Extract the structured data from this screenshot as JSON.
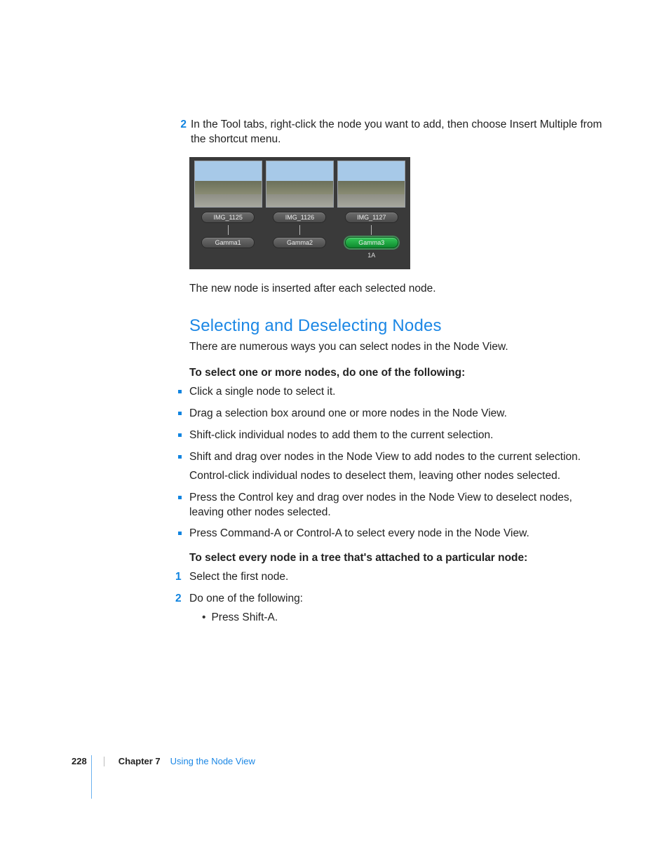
{
  "step2": {
    "number": "2",
    "text": "In the Tool tabs, right-click the node you want to add, then choose Insert Multiple from the shortcut menu."
  },
  "figure": {
    "cols": [
      {
        "top": "IMG_1125",
        "bottom": "Gamma1",
        "selected": false,
        "sub": ""
      },
      {
        "top": "IMG_1126",
        "bottom": "Gamma2",
        "selected": false,
        "sub": ""
      },
      {
        "top": "IMG_1127",
        "bottom": "Gamma3",
        "selected": true,
        "sub": "1A"
      }
    ]
  },
  "after_figure": "The new node is inserted after each selected node.",
  "section": {
    "title": "Selecting and Deselecting Nodes",
    "intro": "There are numerous ways you can select nodes in the Node View.",
    "lead1": "To select one or more nodes, do one of the following:",
    "bullets": [
      {
        "text": "Click a single node to select it."
      },
      {
        "text": "Drag a selection box around one or more nodes in the Node View."
      },
      {
        "text": "Shift-click individual nodes to add them to the current selection."
      },
      {
        "text": "Shift and drag over nodes in the Node View to add nodes to the current selection.",
        "sub": "Control-click individual nodes to deselect them, leaving other nodes selected."
      },
      {
        "text": "Press the Control key and drag over nodes in the Node View to deselect nodes, leaving other nodes selected."
      },
      {
        "text": "Press Command-A or Control-A to select every node in the Node View."
      }
    ],
    "lead2": "To select every node in a tree that's attached to a particular node:",
    "steps": [
      {
        "n": "1",
        "text": "Select the first node."
      },
      {
        "n": "2",
        "text": "Do one of the following:",
        "sub": "Press Shift-A."
      }
    ]
  },
  "footer": {
    "page": "228",
    "chapter_label": "Chapter 7",
    "chapter_name": "Using the Node View"
  }
}
